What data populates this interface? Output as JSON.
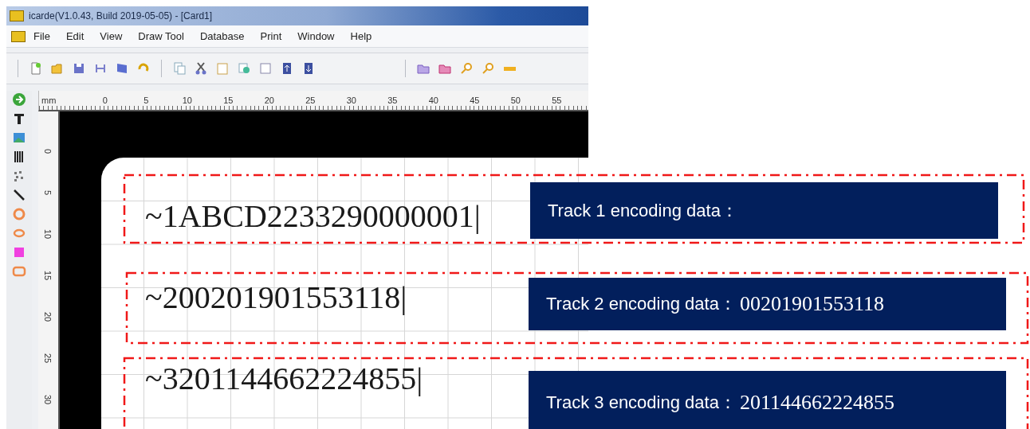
{
  "window": {
    "title": "icarde(V1.0.43, Build 2019-05-05) - [Card1]"
  },
  "menu": [
    "File",
    "Edit",
    "View",
    "Draw Tool",
    "Database",
    "Print",
    "Window",
    "Help"
  ],
  "ruler": {
    "unit": "mm",
    "marks": [
      "0",
      "5",
      "10",
      "15",
      "20",
      "25",
      "30",
      "35",
      "40",
      "45",
      "50",
      "55"
    ]
  },
  "vertical_ruler": {
    "marks": [
      "0",
      "5",
      "10",
      "15",
      "20",
      "25",
      "30"
    ]
  },
  "card": {
    "lines": [
      "~1ABCD2233290000001|",
      "~200201901553118|",
      "~3201144662224855|"
    ]
  },
  "annotations": [
    {
      "label": "Track 1 encoding data："
    },
    {
      "label": "Track 2 encoding data：",
      "value": "00201901553118"
    },
    {
      "label": "Track 3 encoding data：",
      "value": "201144662224855"
    }
  ]
}
